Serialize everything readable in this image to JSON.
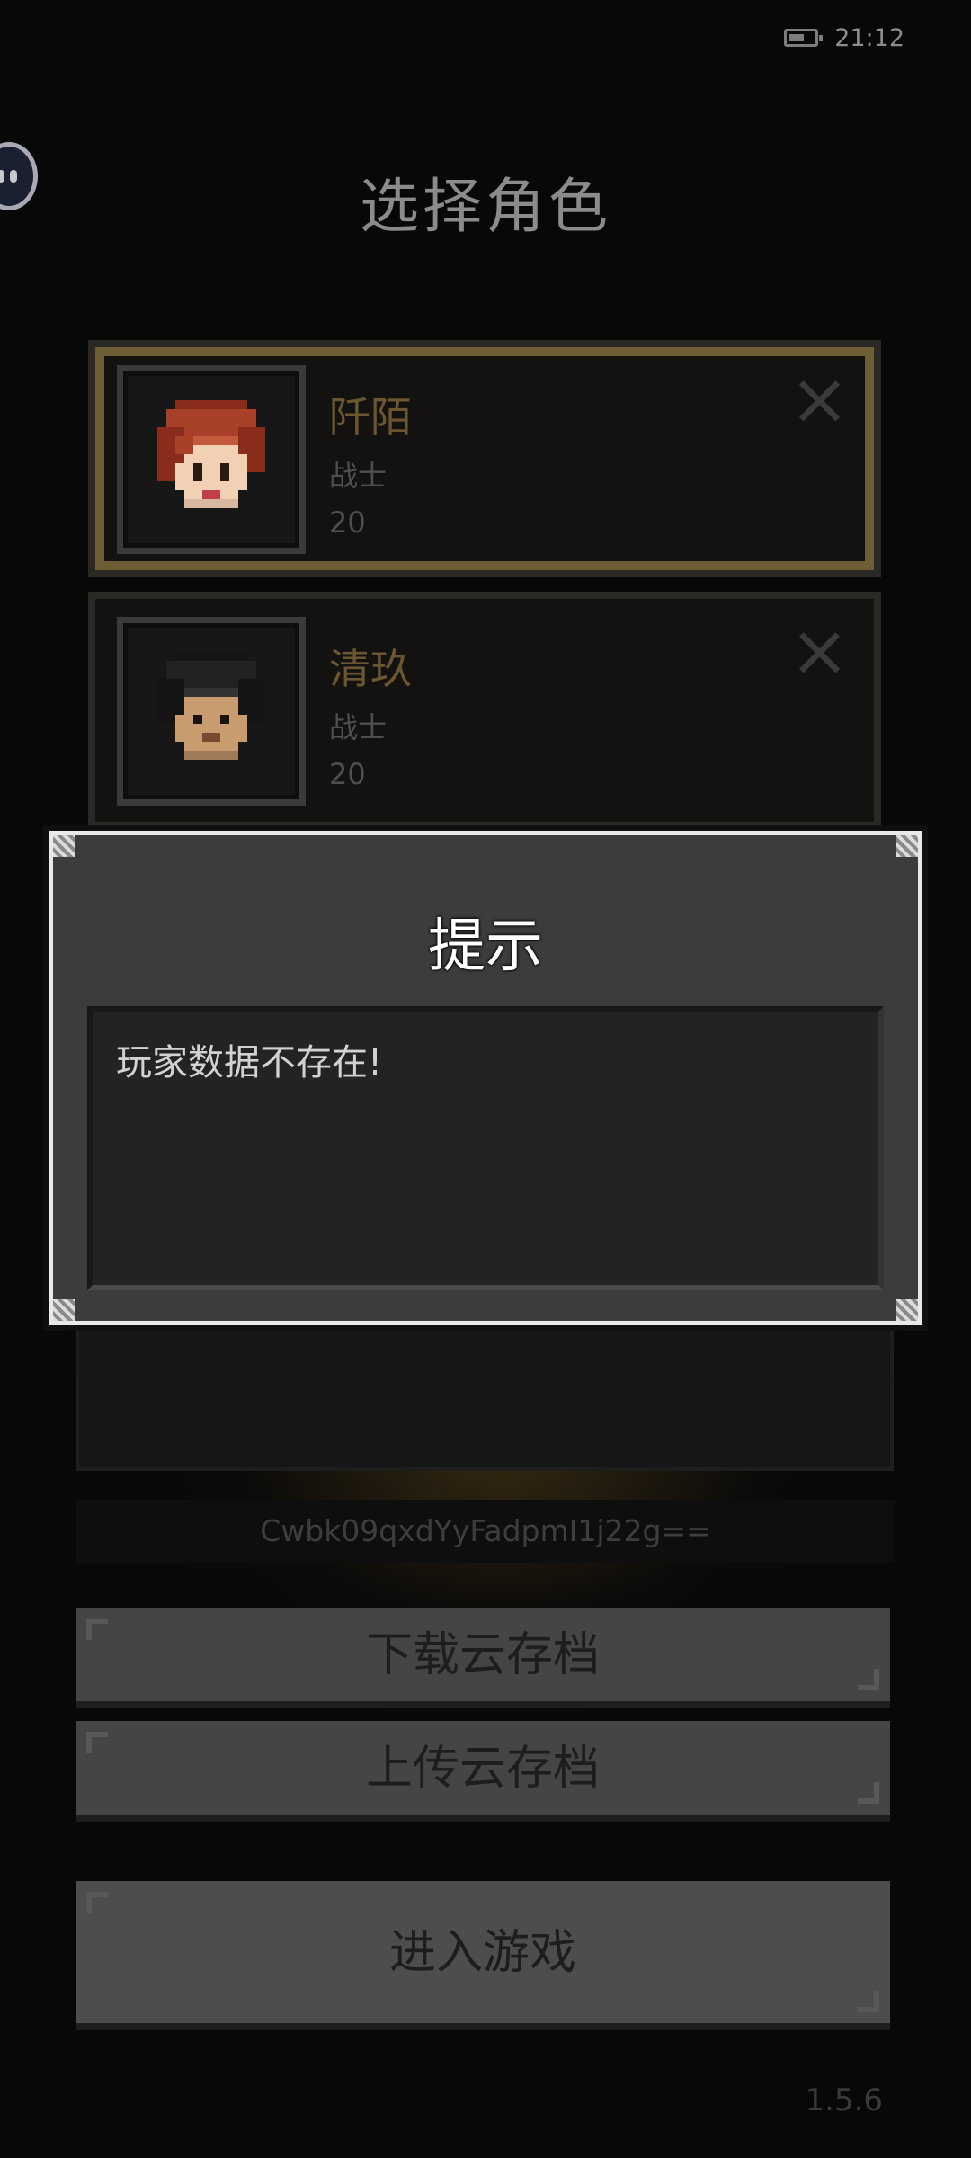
{
  "status_bar": {
    "time": "21:12",
    "battery_icon": "battery-icon"
  },
  "page_title": "选择角色",
  "characters": [
    {
      "name": "阡陌",
      "class": "战士",
      "level": "20",
      "selected": true,
      "hair_color": "#8a2c1c"
    },
    {
      "name": "清玖",
      "class": "战士",
      "level": "20",
      "selected": false,
      "hair_color": "#1a1a1a"
    }
  ],
  "account_id": "Cwbk09qxdYyFadpmI1j22g==",
  "buttons": {
    "download": "下载云存档",
    "upload": "上传云存档",
    "enter": "进入游戏"
  },
  "version": "1.5.6",
  "dialog": {
    "title": "提示",
    "message": "玩家数据不存在!"
  },
  "colors": {
    "accent_gold": "#6e5e36",
    "dialog_border": "#e9e9e9"
  }
}
